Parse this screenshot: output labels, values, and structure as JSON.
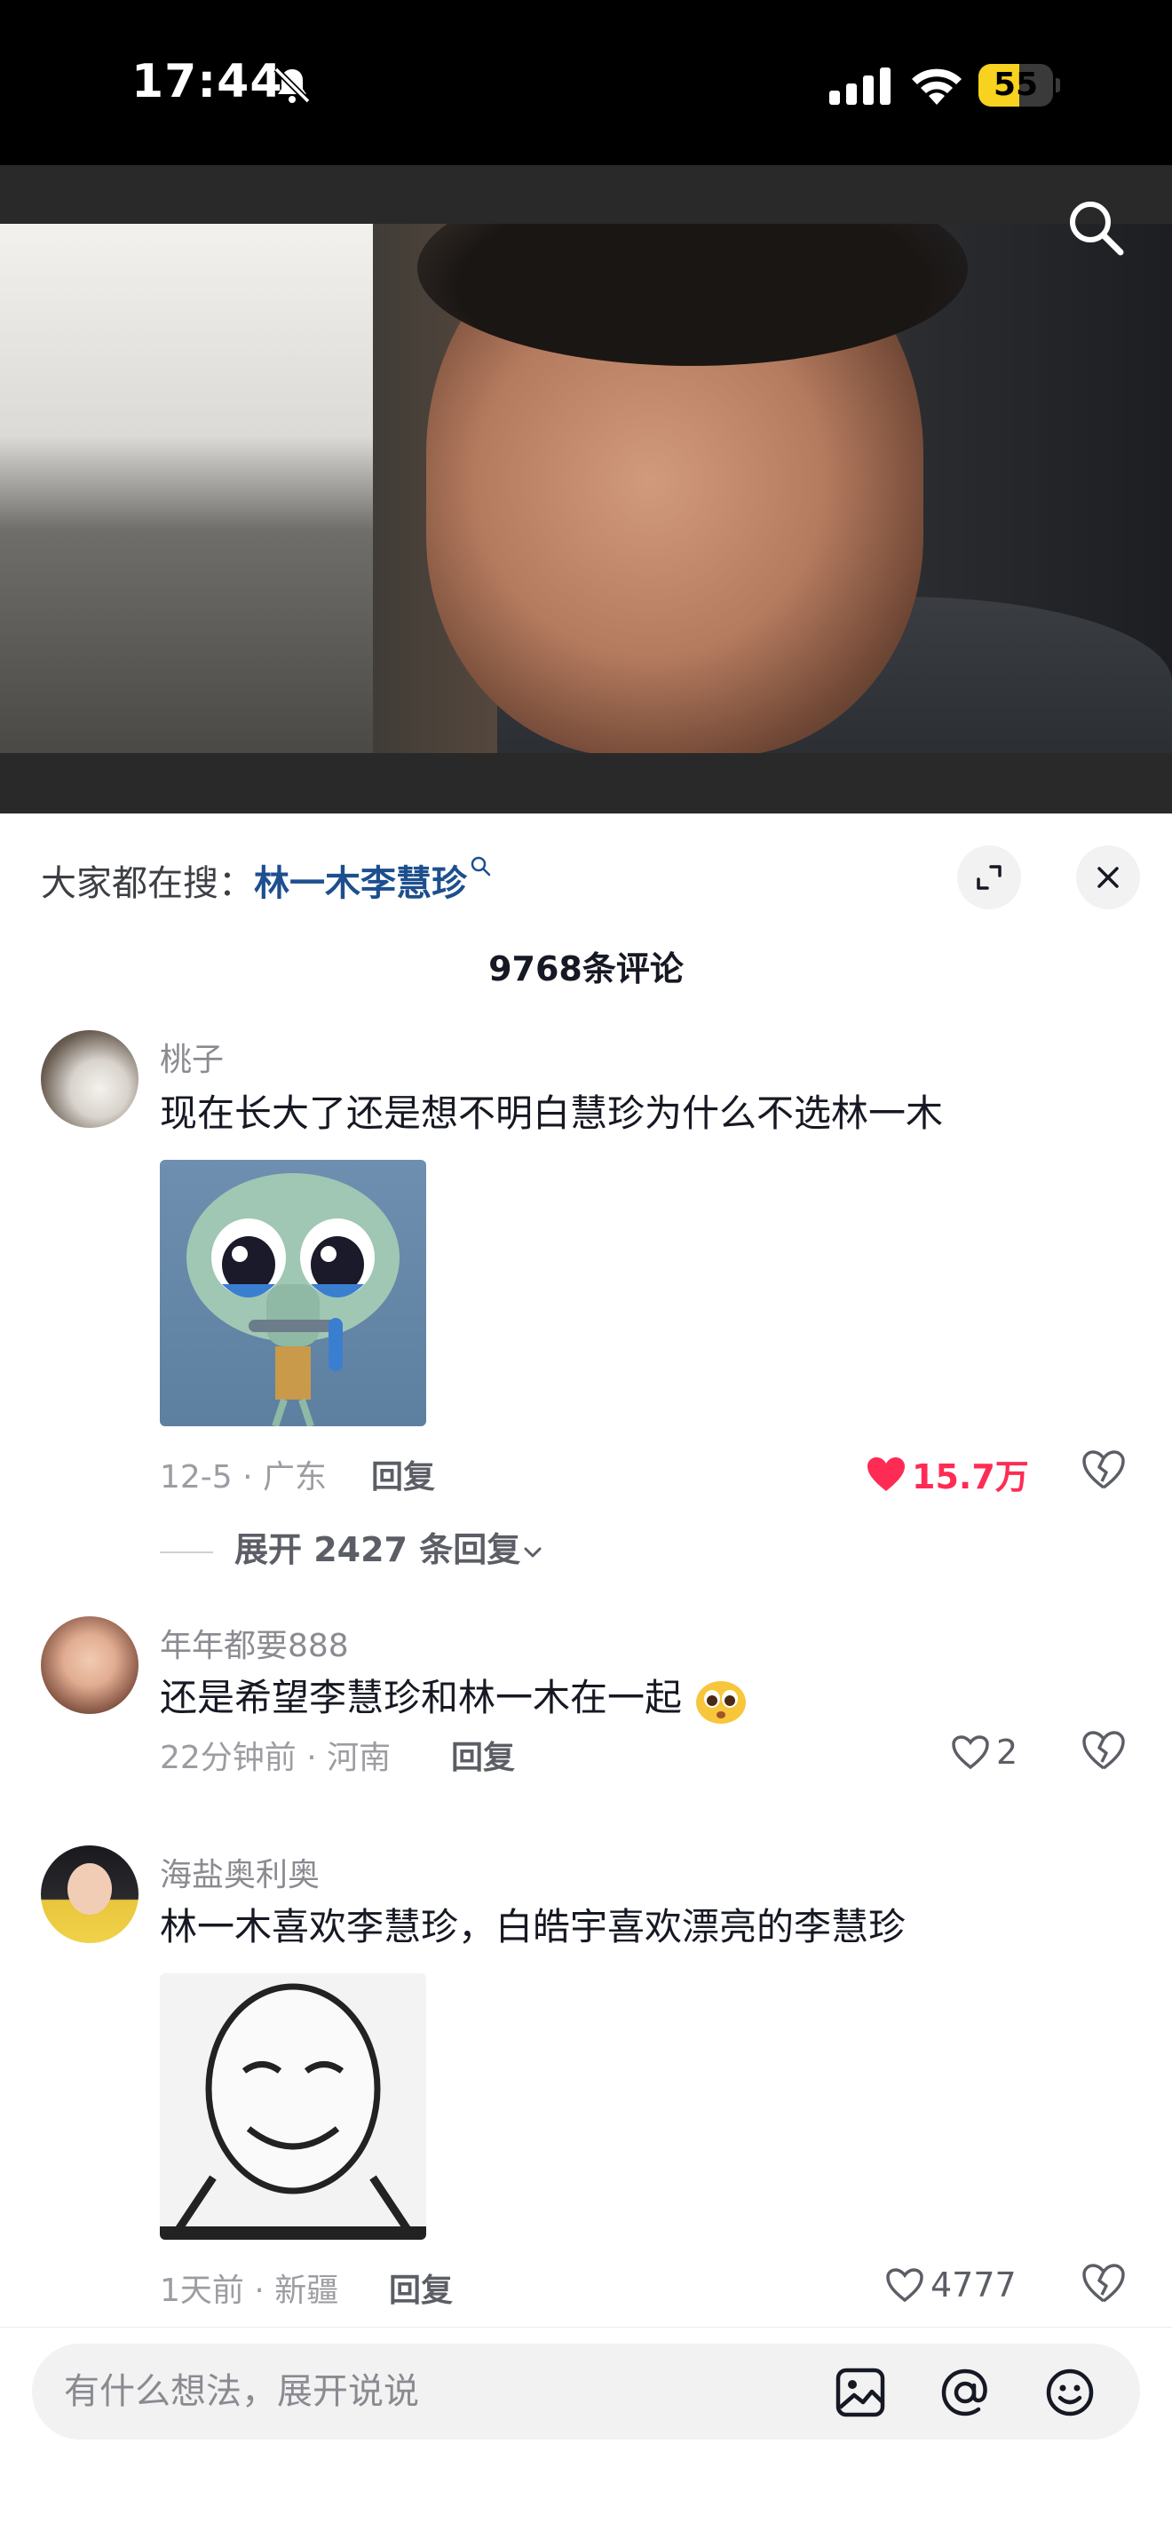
{
  "status_bar": {
    "time": "17:44",
    "battery": "55",
    "battery_level": 0.55,
    "icons": [
      "bell-slash-icon",
      "cellular-signal-icon",
      "wifi-icon",
      "battery-icon"
    ]
  },
  "video": {
    "search_icon": "search-icon"
  },
  "comments_panel": {
    "hot_search_prefix": "大家都在搜：",
    "hot_search_term": "林一木李慧珍",
    "comment_count": "9768条评论",
    "comments": [
      {
        "username": "桃子",
        "text": "现在长大了还是想不明白慧珍为什么不选林一木",
        "meta": "12-5 · 广东",
        "reply": "回复",
        "likes": "15.7万",
        "liked": true,
        "expand_replies": "展开 2427 条回复"
      },
      {
        "username": "年年都要888",
        "text": "还是希望李慧珍和林一木在一起",
        "meta": "22分钟前 · 河南",
        "reply": "回复",
        "likes": "2",
        "liked": false
      },
      {
        "username": "海盐奥利奥",
        "text": "林一木喜欢李慧珍，白皓宇喜欢漂亮的李慧珍",
        "meta": "1天前 · 新疆",
        "reply": "回复",
        "likes": "4777",
        "liked": false
      }
    ]
  },
  "input_bar": {
    "placeholder": "有什么想法，展开说说",
    "icons": [
      "image-icon",
      "at-mention-icon",
      "emoji-icon"
    ]
  },
  "colors": {
    "accent_red": "#fe2c55",
    "link_blue": "#1d4f8e",
    "battery_yellow": "#f7d21f"
  }
}
